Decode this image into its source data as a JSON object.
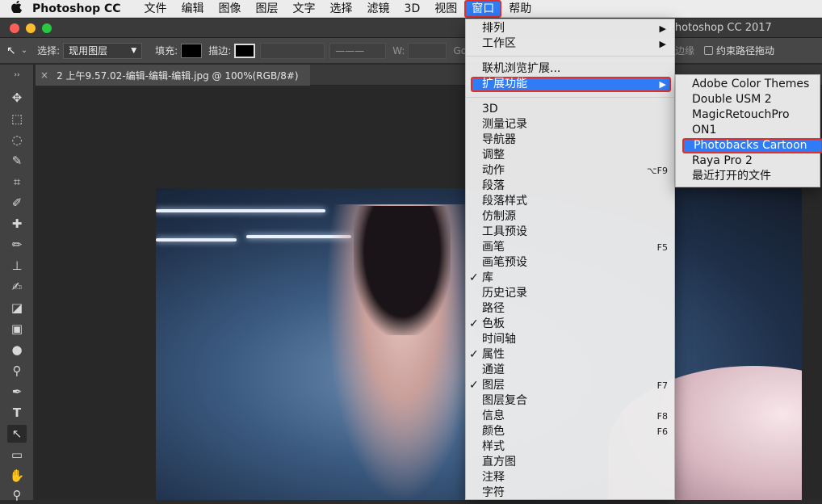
{
  "menubar": {
    "apple": "",
    "app_name": "Photoshop CC",
    "items": [
      "文件",
      "编辑",
      "图像",
      "图层",
      "文字",
      "选择",
      "滤镜",
      "3D",
      "视图",
      "窗口",
      "帮助"
    ]
  },
  "window": {
    "title": "Photoshop CC 2017",
    "colors": {
      "close": "#fc5f57",
      "minimize": "#fdbc2e",
      "maximize": "#2ac840"
    }
  },
  "options": {
    "select_label": "选择:",
    "select_value": "现用图层",
    "fill_label": "填充:",
    "stroke_label": "描边:",
    "w_label": "W:",
    "go_label": "Go",
    "edges_label": "边缘",
    "constrain_label": "约束路径拖动"
  },
  "document": {
    "tab_label": "2 上午9.57.02-编辑-编辑-编辑.jpg @ 100%(RGB/8#)"
  },
  "tools": [
    "move-icon",
    "marquee-icon",
    "lasso-icon",
    "quick-select-icon",
    "crop-icon",
    "eyedropper-icon",
    "healing-icon",
    "brush-icon",
    "stamp-icon",
    "history-brush-icon",
    "eraser-icon",
    "gradient-icon",
    "blur-icon",
    "dodge-icon",
    "pen-icon",
    "type-icon",
    "path-select-icon",
    "rectangle-icon",
    "hand-icon",
    "zoom-icon"
  ],
  "window_menu": {
    "items": [
      {
        "label": "排列",
        "submenu": true
      },
      {
        "label": "工作区",
        "submenu": true
      },
      {
        "label": "联机浏览扩展..."
      },
      {
        "label": "扩展功能",
        "submenu": true,
        "highlighted": true
      },
      {
        "label": "3D"
      },
      {
        "label": "测量记录"
      },
      {
        "label": "导航器"
      },
      {
        "label": "调整"
      },
      {
        "label": "动作",
        "shortcut": "⌥F9"
      },
      {
        "label": "段落"
      },
      {
        "label": "段落样式"
      },
      {
        "label": "仿制源"
      },
      {
        "label": "工具预设"
      },
      {
        "label": "画笔",
        "shortcut": "F5"
      },
      {
        "label": "画笔预设"
      },
      {
        "label": "库",
        "checked": true
      },
      {
        "label": "历史记录"
      },
      {
        "label": "路径"
      },
      {
        "label": "色板",
        "checked": true
      },
      {
        "label": "时间轴"
      },
      {
        "label": "属性",
        "checked": true
      },
      {
        "label": "通道"
      },
      {
        "label": "图层",
        "checked": true,
        "shortcut": "F7"
      },
      {
        "label": "图层复合"
      },
      {
        "label": "信息",
        "shortcut": "F8"
      },
      {
        "label": "颜色",
        "shortcut": "F6"
      },
      {
        "label": "样式"
      },
      {
        "label": "直方图"
      },
      {
        "label": "注释"
      },
      {
        "label": "字符"
      }
    ]
  },
  "extensions_submenu": {
    "items": [
      {
        "label": "Adobe Color Themes"
      },
      {
        "label": "Double USM 2"
      },
      {
        "label": "MagicRetouchPro"
      },
      {
        "label": "ON1"
      },
      {
        "label": "Photobacks Cartoon",
        "highlighted": true
      },
      {
        "label": "Raya Pro 2"
      },
      {
        "label": "最近打开的文件"
      }
    ]
  },
  "glyphs": {
    "check": "✓",
    "arrow": "▶",
    "close_tab": "×"
  }
}
